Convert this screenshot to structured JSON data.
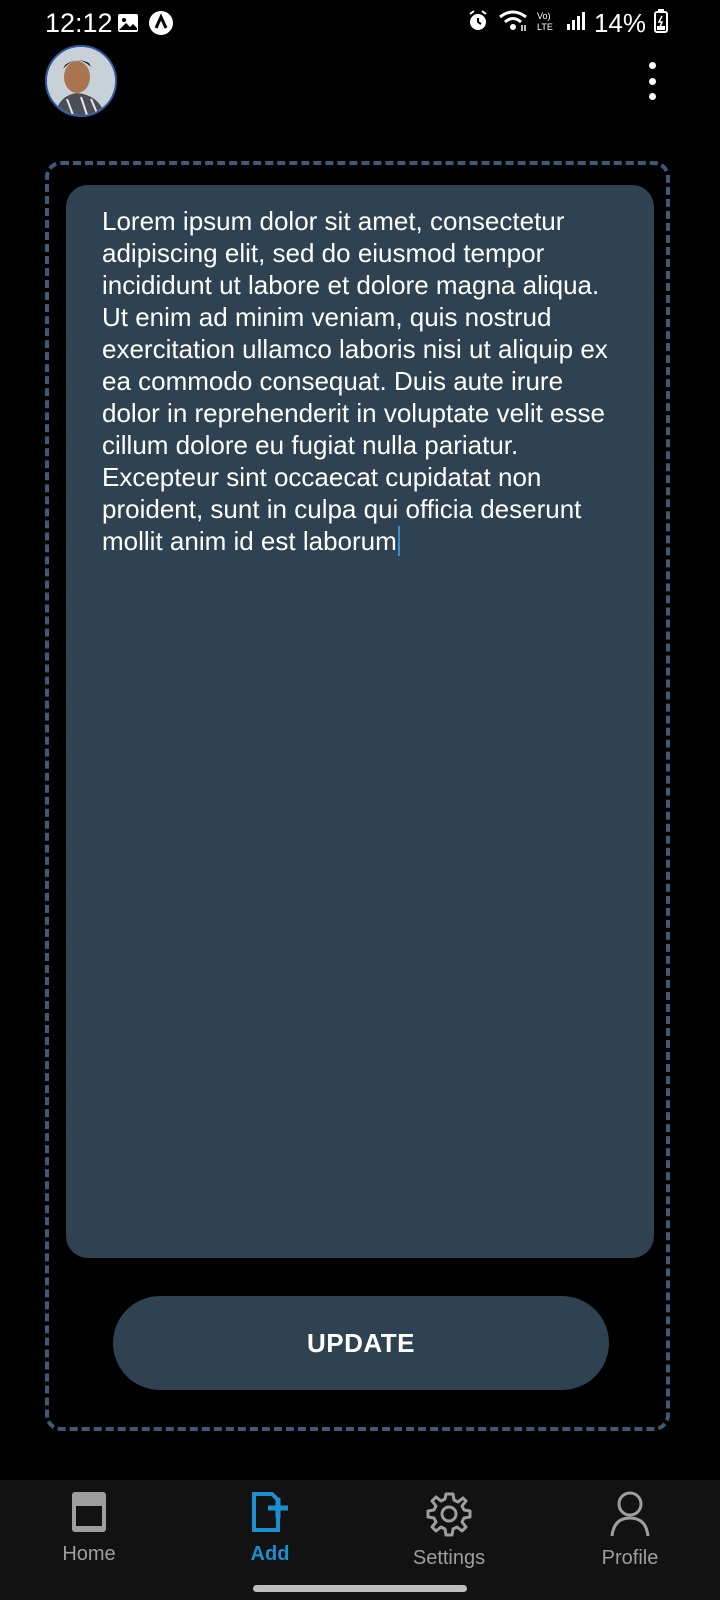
{
  "status_bar": {
    "time": "12:12",
    "battery_percent": "14%",
    "icons_left": [
      "image-icon",
      "app-notification-icon"
    ],
    "icons_right": [
      "alarm-icon",
      "wifi-icon",
      "volte-icon",
      "signal-icon",
      "battery-icon"
    ]
  },
  "header": {
    "avatar_icon": "user-avatar",
    "menu_icon": "more-vertical-icon"
  },
  "editor": {
    "text": "Lorem ipsum dolor sit amet, consectetur adipiscing elit, sed do eiusmod tempor incididunt ut labore et dolore magna aliqua. Ut enim ad minim veniam, quis nostrud exercitation ullamco laboris nisi ut aliquip ex ea commodo consequat. Duis aute irure dolor in reprehenderit in voluptate velit esse cillum dolore eu fugiat nulla pariatur. Excepteur sint occaecat cupidatat non proident, sunt in culpa qui officia deserunt mollit anim id est laborum",
    "card_color": "#2f4252",
    "frame_color": "#3e5a78"
  },
  "actions": {
    "update_label": "UPDATE"
  },
  "nav": {
    "accent": "#1c8fd0",
    "items": [
      {
        "label": "Home",
        "icon": "home-tablet-icon",
        "active": false
      },
      {
        "label": "Add",
        "icon": "add-file-icon",
        "active": true
      },
      {
        "label": "Settings",
        "icon": "gear-icon",
        "active": false
      },
      {
        "label": "Profile",
        "icon": "person-icon",
        "active": false
      }
    ]
  }
}
